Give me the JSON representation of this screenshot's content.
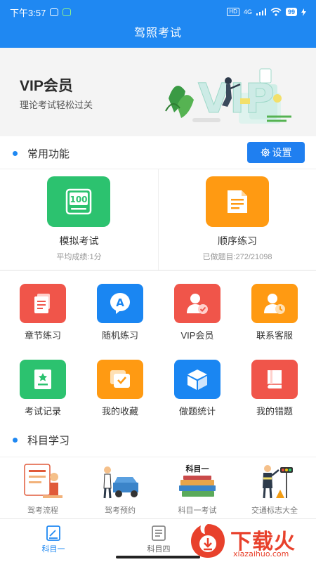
{
  "status_bar": {
    "time": "下午3:57",
    "network": "4G",
    "hd": "HD",
    "battery": "99"
  },
  "app_title": "驾照考试",
  "banner": {
    "title": "VIP会员",
    "subtitle": "理论考试轻松过关",
    "art_text": "VIP"
  },
  "common_section": {
    "title": "常用功能",
    "settings_label": "设置"
  },
  "big_features": [
    {
      "label": "模拟考试",
      "sub": "平均成绩:1分",
      "icon": "exam-100-icon",
      "color": "#2cc26f",
      "icon_text": "100"
    },
    {
      "label": "顺序练习",
      "sub": "已做题目:272/21098",
      "icon": "document-icon",
      "color": "#ff9a12"
    }
  ],
  "grid_features": [
    {
      "label": "章节练习",
      "icon": "chapter-docs-icon",
      "color": "#f0554a"
    },
    {
      "label": "随机练习",
      "icon": "random-a-icon",
      "color": "#1a86f2",
      "icon_text": "A"
    },
    {
      "label": "VIP会员",
      "icon": "vip-user-icon",
      "color": "#f0554a"
    },
    {
      "label": "联系客服",
      "icon": "customer-service-icon",
      "color": "#ff9a12"
    },
    {
      "label": "考试记录",
      "icon": "exam-record-icon",
      "color": "#2cc26f"
    },
    {
      "label": "我的收藏",
      "icon": "favorites-icon",
      "color": "#ff9a12"
    },
    {
      "label": "做题统计",
      "icon": "statistics-box-icon",
      "color": "#1a86f2"
    },
    {
      "label": "我的错题",
      "icon": "wrong-questions-book-icon",
      "color": "#f0554a"
    }
  ],
  "subject_section": {
    "title": "科目学习"
  },
  "subjects": [
    {
      "label": "驾考流程",
      "art": "exam-process-illustration"
    },
    {
      "label": "驾考预约",
      "art": "exam-booking-illustration"
    },
    {
      "label": "科目一考试",
      "art": "subject-one-books-illustration",
      "art_text": "科目一"
    },
    {
      "label": "交通标志大全",
      "art": "traffic-signs-illustration"
    }
  ],
  "tabs": [
    {
      "label": "科目一",
      "active": true,
      "icon": "subject-one-tab-icon"
    },
    {
      "label": "科目四",
      "active": false,
      "icon": "subject-four-tab-icon"
    }
  ],
  "watermark": {
    "text": "下载火",
    "url": "xiazaihuo.com"
  },
  "colors": {
    "primary": "#1f88f2",
    "green": "#2cc26f",
    "orange": "#ff9a12",
    "red": "#f0554a"
  }
}
